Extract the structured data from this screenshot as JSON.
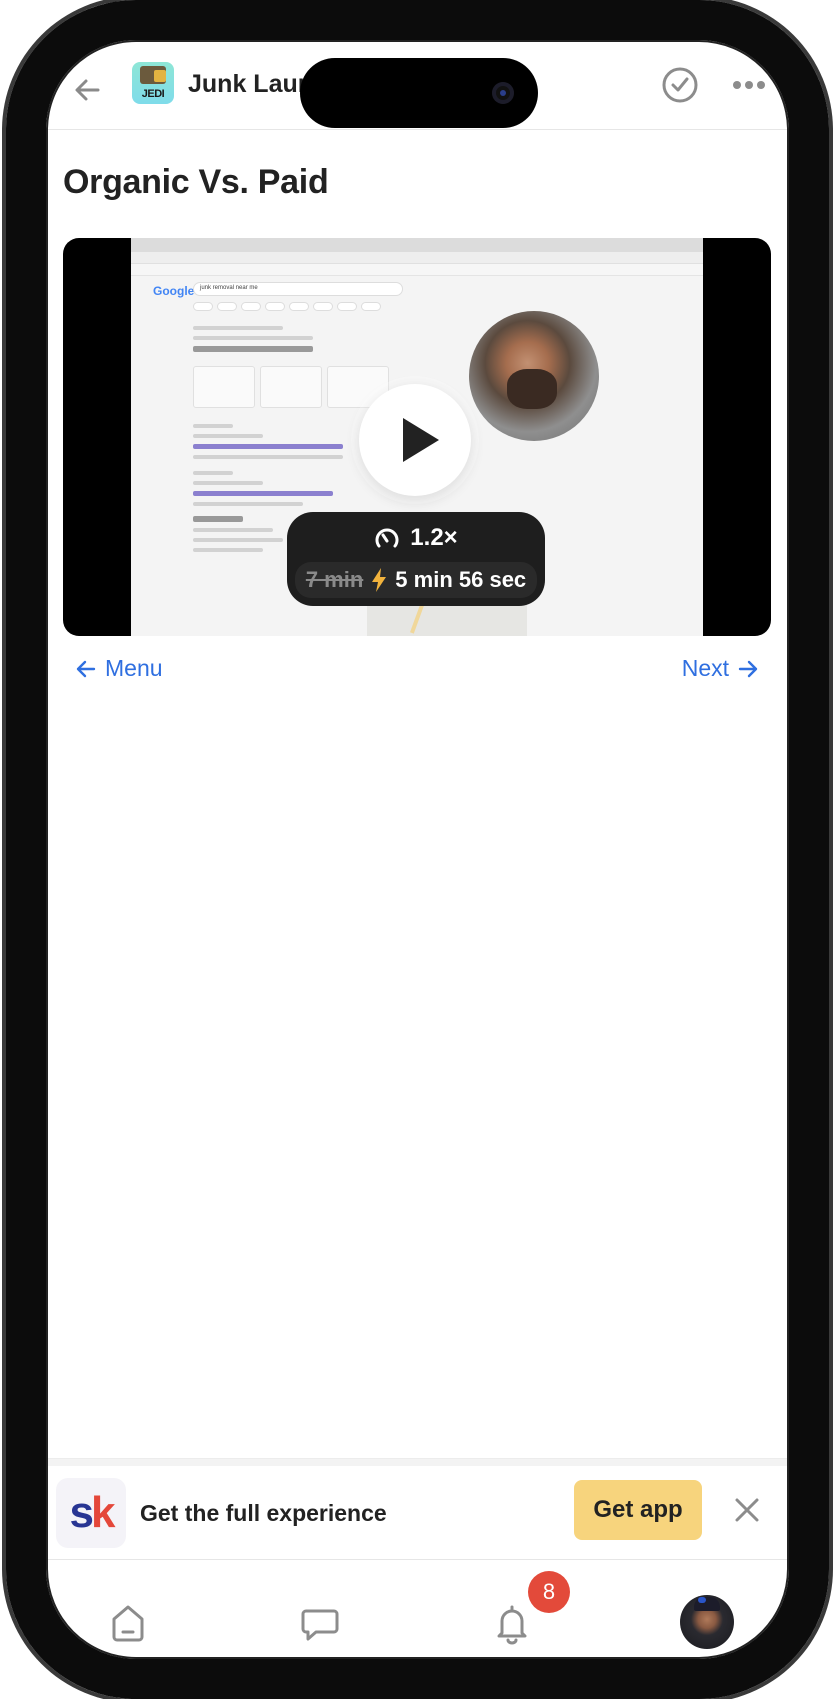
{
  "header": {
    "app_title": "Junk Laun",
    "app_logo_text": "JEDI",
    "back_icon": "arrow-left-icon",
    "complete_icon": "check-circle-icon",
    "more_icon": "ellipsis-icon"
  },
  "lesson": {
    "title": "Organic Vs. Paid"
  },
  "video": {
    "thumbnail_search_query": "junk removal near me",
    "thumbnail_logo": "Google",
    "play_icon": "play-icon",
    "speed": "1.2×",
    "original_duration": "7 min",
    "accelerated_duration": "5 min 56 sec",
    "speed_icon": "gauge-icon",
    "bolt_icon": "lightning-bolt-icon"
  },
  "navigation": {
    "menu_label": "Menu",
    "next_label": "Next"
  },
  "banner": {
    "logo_s": "s",
    "logo_k": "k",
    "text": "Get the full experience",
    "cta_label": "Get app"
  },
  "bottom_nav": {
    "items": [
      {
        "name": "home",
        "icon": "home-icon"
      },
      {
        "name": "chat",
        "icon": "chat-bubble-icon"
      },
      {
        "name": "notifications",
        "icon": "bell-icon",
        "badge": "8"
      },
      {
        "name": "profile",
        "icon": "avatar"
      }
    ]
  },
  "colors": {
    "link_blue": "#2f6fe0",
    "cta_yellow": "#f7d47d",
    "badge_red": "#e34a3a",
    "bolt_orange": "#f2b33d"
  }
}
